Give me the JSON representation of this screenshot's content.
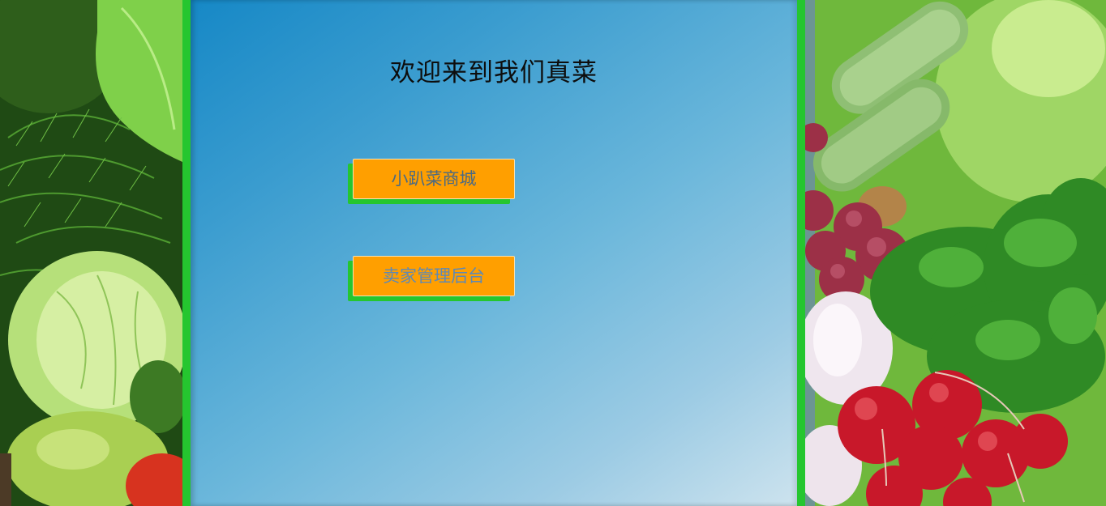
{
  "header": {
    "title": "欢迎来到我们真菜"
  },
  "nav": {
    "mall_label": "小趴菜商城",
    "seller_label": "卖家管理后台"
  },
  "colors": {
    "panel_gradient_start": "#1688c6",
    "panel_gradient_end": "#cde3ee",
    "panel_border": "#25c62f",
    "button_bg": "#ff9f00",
    "button_shadow": "#25c62f"
  },
  "images": {
    "left": "vegetables-dill-cabbage-apple-photo",
    "right": "vegetables-zucchini-grapes-garlic-radish-parsley-photo"
  }
}
